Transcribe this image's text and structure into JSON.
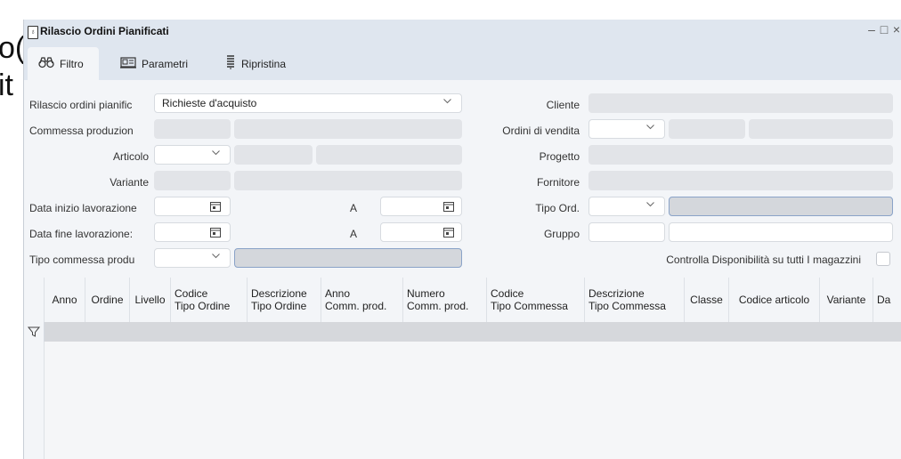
{
  "background": {
    "line1": "o(",
    "line2": "it"
  },
  "window": {
    "title": "Rilascio Ordini Pianificati",
    "controls": {
      "minimize": "–",
      "maximize": "□",
      "close": "×"
    }
  },
  "toolbar": {
    "tabs": [
      {
        "label": "Filtro",
        "icon": "binoculars-icon"
      },
      {
        "label": "Parametri",
        "icon": "parameters-icon"
      },
      {
        "label": "Ripristina",
        "icon": "reset-icon"
      }
    ]
  },
  "form": {
    "rilascio_label": "Rilascio ordini pianific",
    "rilascio_value": "Richieste d'acquisto",
    "commessa_label": "Commessa produzion",
    "articolo_label": "Articolo",
    "variante_label": "Variante",
    "data_inizio_label": "Data inizio lavorazione",
    "data_fine_label": "Data fine lavorazione:",
    "tipo_commessa_label": "Tipo commessa produ",
    "a_label": "A",
    "cliente_label": "Cliente",
    "ordini_vendita_label": "Ordini di vendita",
    "progetto_label": "Progetto",
    "fornitore_label": "Fornitore",
    "tipo_ord_label": "Tipo Ord.",
    "gruppo_label": "Gruppo",
    "controlla_label": "Controlla Disponibilità su tutti I magazzini"
  },
  "grid": {
    "columns": [
      {
        "l1": "Anno",
        "l2": ""
      },
      {
        "l1": "Ordine",
        "l2": ""
      },
      {
        "l1": "Livello",
        "l2": ""
      },
      {
        "l1": "Codice",
        "l2": "Tipo Ordine"
      },
      {
        "l1": "Descrizione",
        "l2": "Tipo Ordine"
      },
      {
        "l1": "Anno",
        "l2": "Comm. prod."
      },
      {
        "l1": "Numero",
        "l2": "Comm. prod."
      },
      {
        "l1": "Codice",
        "l2": "Tipo Commessa"
      },
      {
        "l1": "Descrizione",
        "l2": "Tipo Commessa"
      },
      {
        "l1": "Classe",
        "l2": ""
      },
      {
        "l1": "Codice articolo",
        "l2": ""
      },
      {
        "l1": "Variante",
        "l2": ""
      },
      {
        "l1": "Da",
        "l2": ""
      }
    ]
  },
  "colors": {
    "titlebar": "#dfe6ef",
    "panel": "#f3f5f8",
    "field_disabled": "#e2e4e8",
    "accent_border": "#8aa3c8"
  }
}
